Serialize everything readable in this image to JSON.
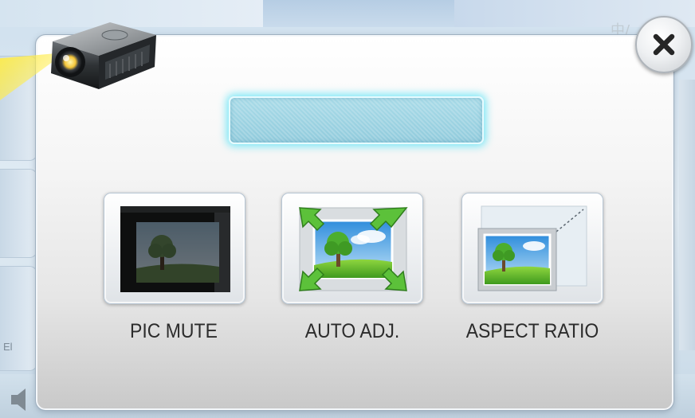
{
  "background": {
    "corner_text": "中/",
    "left_label": "El"
  },
  "dialog": {
    "name_field": {
      "value": ""
    },
    "buttons": [
      {
        "label": "PIC MUTE",
        "icon": "pic-mute-icon"
      },
      {
        "label": "AUTO ADJ.",
        "icon": "auto-adjust-icon"
      },
      {
        "label": "ASPECT RATIO",
        "icon": "aspect-ratio-icon"
      }
    ],
    "close_icon": "close-icon",
    "header_icon": "projector-icon"
  },
  "colors": {
    "field_glow": "#66e4f6",
    "beam": "#ffe846",
    "arrow_green": "#5cc13a"
  }
}
